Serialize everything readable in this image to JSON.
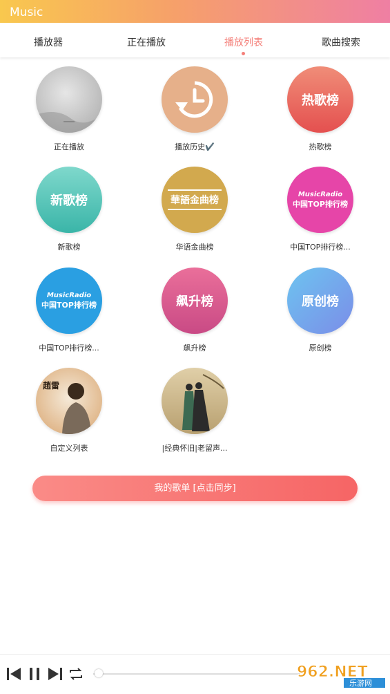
{
  "app": {
    "title": "Music"
  },
  "tabs": [
    {
      "label": "播放器",
      "active": false
    },
    {
      "label": "正在播放",
      "active": false
    },
    {
      "label": "播放列表",
      "active": true
    },
    {
      "label": "歌曲搜索",
      "active": false
    }
  ],
  "playlists": [
    {
      "label": "正在播放",
      "cover_text": "",
      "colors": [
        "#d9d9d9",
        "#a9a9a9"
      ]
    },
    {
      "label": "播放历史✔️",
      "cover_text": "",
      "icon": "history-clock-icon",
      "colors": [
        "#e6b08a",
        "#e6b08a"
      ]
    },
    {
      "label": "热歌榜",
      "cover_text": "热歌榜",
      "colors": [
        "#f08d78",
        "#e4504f"
      ]
    },
    {
      "label": "新歌榜",
      "cover_text": "新歌榜",
      "colors": [
        "#7fd8cc",
        "#3ab5a8"
      ]
    },
    {
      "label": "华语金曲榜",
      "cover_text": "華語金曲榜",
      "colors": [
        "#d2a94e",
        "#c59a3c"
      ]
    },
    {
      "label": "中国TOP排行榜...",
      "cover_text": "MusicRadio",
      "cover_sub": "中国TOP排行榜",
      "colors": [
        "#f057b5",
        "#e03896"
      ]
    },
    {
      "label": "中国TOP排行榜...",
      "cover_text": "MusicRadio",
      "cover_sub": "中国TOP排行榜",
      "colors": [
        "#2ea8e8",
        "#1f8fd3"
      ]
    },
    {
      "label": "飙升榜",
      "cover_text": "飙升榜",
      "colors": [
        "#ea6f9a",
        "#c94a85"
      ]
    },
    {
      "label": "原创榜",
      "cover_text": "原创榜",
      "colors": [
        "#6dbaf0",
        "#7b8de8"
      ]
    },
    {
      "label": "自定义列表",
      "cover_text": "",
      "colors": [
        "#f1e2cd",
        "#d9a56f"
      ]
    },
    {
      "label": "|经典怀旧|老留声...",
      "cover_text": "",
      "colors": [
        "#d9c6a0",
        "#b8a070"
      ]
    }
  ],
  "sync_button": {
    "label": "我的歌单 [点击同步]"
  },
  "player": {
    "progress": 0.0
  },
  "watermark": {
    "text": "962.NET",
    "sub": "乐游网"
  },
  "colors": {
    "accent": "#f47f79"
  }
}
